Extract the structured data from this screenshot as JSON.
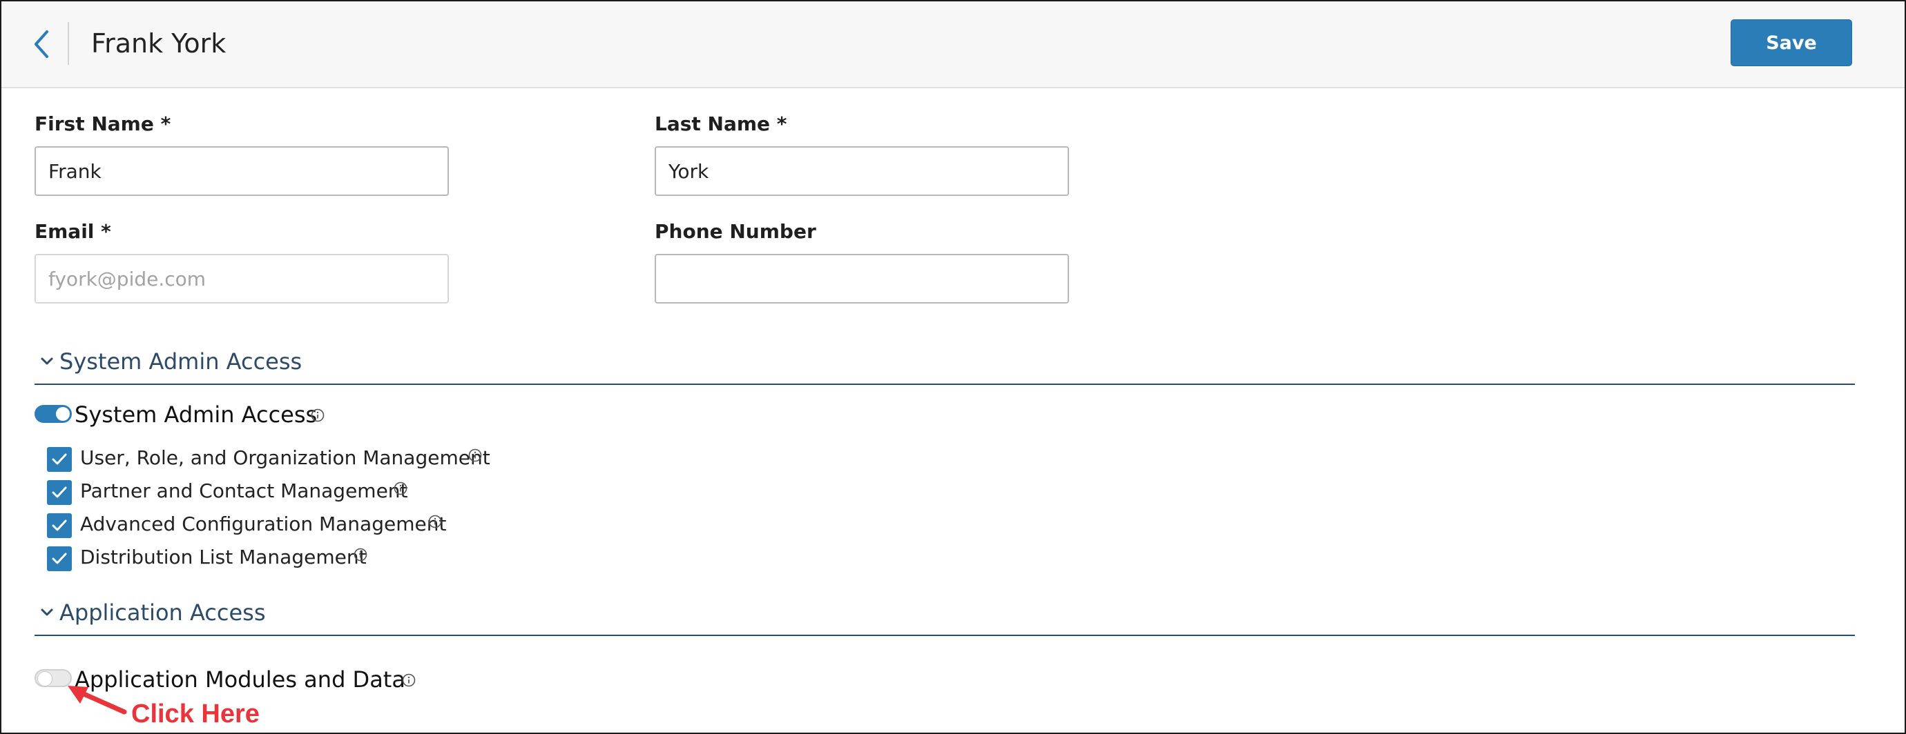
{
  "header": {
    "title": "Frank York",
    "back_icon": "chevron-left-icon",
    "save_label": "Save"
  },
  "form": {
    "first_name": {
      "label": "First Name *",
      "value": "Frank"
    },
    "last_name": {
      "label": "Last Name *",
      "value": "York"
    },
    "email": {
      "label": "Email *",
      "value": "",
      "placeholder": "fyork@pide.com"
    },
    "phone": {
      "label": "Phone Number",
      "value": "",
      "placeholder": ""
    }
  },
  "system_admin_section": {
    "title": "System Admin Access",
    "toggle": {
      "label": "System Admin Access",
      "on": true
    },
    "permissions": [
      {
        "label": "User, Role, and Organization Management",
        "checked": true
      },
      {
        "label": "Partner and Contact Management",
        "checked": true
      },
      {
        "label": "Advanced Configuration Management",
        "checked": true
      },
      {
        "label": "Distribution List Management",
        "checked": true
      }
    ]
  },
  "application_section": {
    "title": "Application Access",
    "toggle": {
      "label": "Application Modules and Data",
      "on": false
    }
  },
  "annotation": {
    "text": "Click Here"
  },
  "colors": {
    "primary": "#2a7db7",
    "section_heading": "#2c4a6a",
    "annotation_red": "#e8343a",
    "header_bg": "#f7f7f7"
  }
}
